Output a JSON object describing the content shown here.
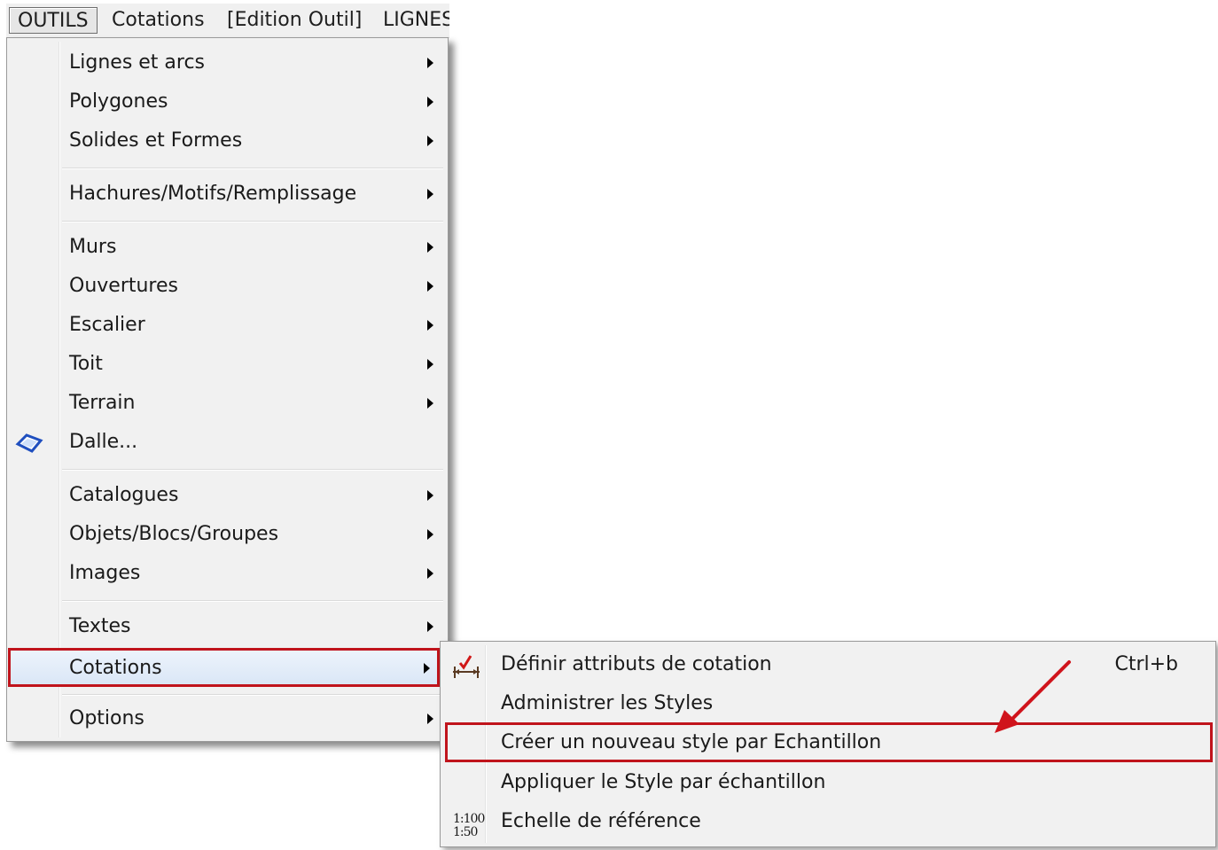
{
  "menubar": {
    "items": [
      "OUTILS",
      "Cotations",
      "[Edition Outil]",
      "LIGNES"
    ]
  },
  "menu": {
    "items": [
      {
        "label": "Lignes et arcs"
      },
      {
        "label": "Polygones"
      },
      {
        "label": "Solides et Formes"
      },
      {
        "label": "Hachures/Motifs/Remplissage"
      },
      {
        "label": "Murs"
      },
      {
        "label": "Ouvertures"
      },
      {
        "label": "Escalier"
      },
      {
        "label": "Toit"
      },
      {
        "label": "Terrain"
      },
      {
        "label": "Dalle...",
        "icon": "slab-icon"
      },
      {
        "label": "Catalogues"
      },
      {
        "label": "Objets/Blocs/Groupes"
      },
      {
        "label": "Images"
      },
      {
        "label": "Textes"
      },
      {
        "label": "Cotations",
        "highlighted": true
      },
      {
        "label": "Options"
      }
    ]
  },
  "submenu": {
    "items": [
      {
        "label": "Définir attributs de cotation",
        "shortcut": "Ctrl+b",
        "icon": "dimension-check-icon"
      },
      {
        "label": "Administrer les Styles"
      },
      {
        "label": "Créer un nouveau style par Echantillon",
        "highlighted": true
      },
      {
        "label": "Appliquer le Style par échantillon"
      },
      {
        "label": "Echelle de référence",
        "icon": "scale-icon",
        "icon_text": [
          "1:100",
          "1:50"
        ]
      }
    ]
  },
  "colors": {
    "highlight_box": "#c0141c",
    "annotation_arrow": "#d0141c",
    "menu_bg": "#f1f1f1",
    "hover_bg": "#dce8f6"
  }
}
